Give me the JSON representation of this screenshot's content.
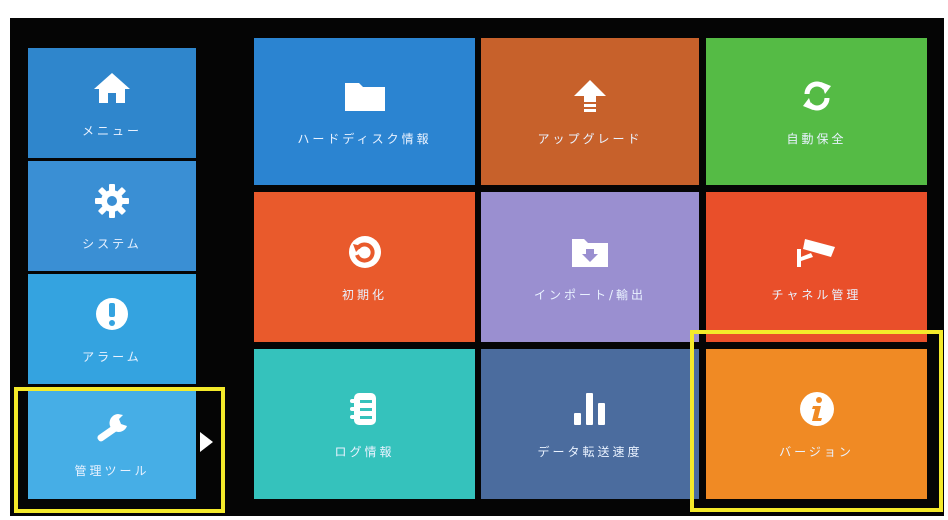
{
  "sidebar": {
    "items": [
      {
        "label": "メニュー",
        "icon": "home-icon",
        "color": "#2f86cc"
      },
      {
        "label": "システム",
        "icon": "gear-icon",
        "color": "#3a8fd4"
      },
      {
        "label": "アラーム",
        "icon": "alert-icon",
        "color": "#34a3e0"
      },
      {
        "label": "管理ツール",
        "icon": "wrench-icon",
        "color": "#46aee6",
        "selected": true
      }
    ]
  },
  "tiles": [
    {
      "label": "ハードディスク情報",
      "icon": "folder-icon",
      "color": "#2b84d1"
    },
    {
      "label": "アップグレード",
      "icon": "upgrade-arrow-icon",
      "color": "#c7612b"
    },
    {
      "label": "自動保全",
      "icon": "refresh-icon",
      "color": "#55bb45"
    },
    {
      "label": "初期化",
      "icon": "restore-icon",
      "color": "#e95a2c"
    },
    {
      "label": "インポート/輸出",
      "icon": "import-folder-icon",
      "color": "#9a8fd0"
    },
    {
      "label": "チャネル管理",
      "icon": "camera-icon",
      "color": "#e94f2a"
    },
    {
      "label": "ログ情報",
      "icon": "log-icon",
      "color": "#35c2bc"
    },
    {
      "label": "データ転送速度",
      "icon": "bar-chart-icon",
      "color": "#4b6c9e"
    },
    {
      "label": "バージョン",
      "icon": "info-icon",
      "color": "#f08a24",
      "highlighted": true
    }
  ],
  "highlight_color": "#f4ea2a"
}
